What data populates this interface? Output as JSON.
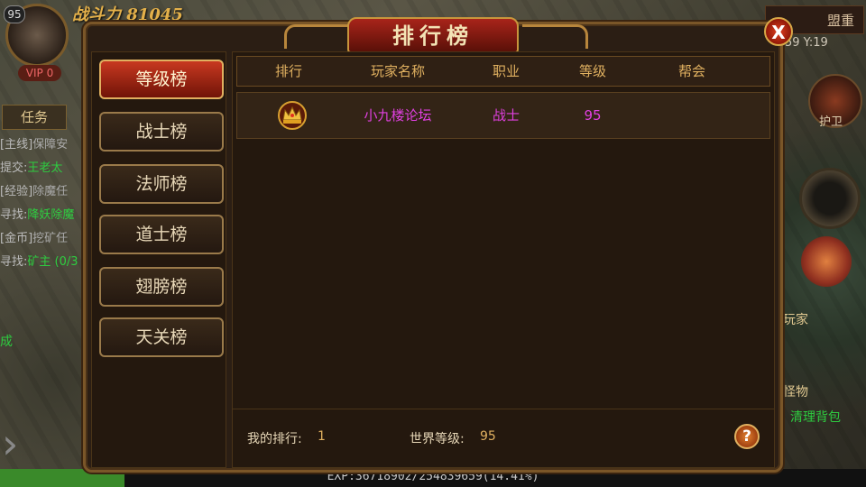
{
  "hud": {
    "level": "95",
    "power_value": "战斗力 81045",
    "vip": "VIP 0",
    "task_tab": "任务",
    "quests": [
      {
        "tag": "[主线]",
        "text": "保障安",
        "cls": "main"
      },
      {
        "tag": "提交:",
        "text": "王老太",
        "cls": "g"
      },
      {
        "tag": "[经验]",
        "text": "除魔任",
        "cls": "main"
      },
      {
        "tag": "寻找:",
        "text": "降妖除魔",
        "cls": "g"
      },
      {
        "tag": "[金币]",
        "text": "挖矿任",
        "cls": "main"
      },
      {
        "tag": "寻找:",
        "text": "矿主 (0/3",
        "cls": "g"
      }
    ],
    "done_text": "成",
    "alliance_btn": "盟重",
    "coord": "59 Y:19",
    "guard_label": "护卫",
    "player_label": "玩家",
    "monster_label": "怪物",
    "clean_bag_label": "清理背包",
    "exp_text": "EXP:36718902/254839659(14.41%)",
    "exp_ratio": 0.1441
  },
  "modal": {
    "title": "排行榜",
    "close_label": "X",
    "tabs": [
      "等级榜",
      "战士榜",
      "法师榜",
      "道士榜",
      "翅膀榜",
      "天关榜"
    ],
    "active_tab": 0,
    "table": {
      "headers": [
        "排行",
        "玩家名称",
        "职业",
        "等级",
        "帮会"
      ],
      "rows": [
        {
          "rank_icon": "crown-icon",
          "name": "小九楼论坛",
          "class": "战士",
          "level": "95",
          "guild": ""
        }
      ]
    },
    "footer": {
      "my_rank_label": "我的排行:",
      "my_rank_value": "1",
      "world_level_label": "世界等级:",
      "world_level_value": "95",
      "help_label": "?"
    }
  },
  "colors": {
    "accent_gold": "#e0b060",
    "player_name": "#e040e0",
    "active_tab": "#c83820",
    "quest_green": "#2ecc40"
  }
}
